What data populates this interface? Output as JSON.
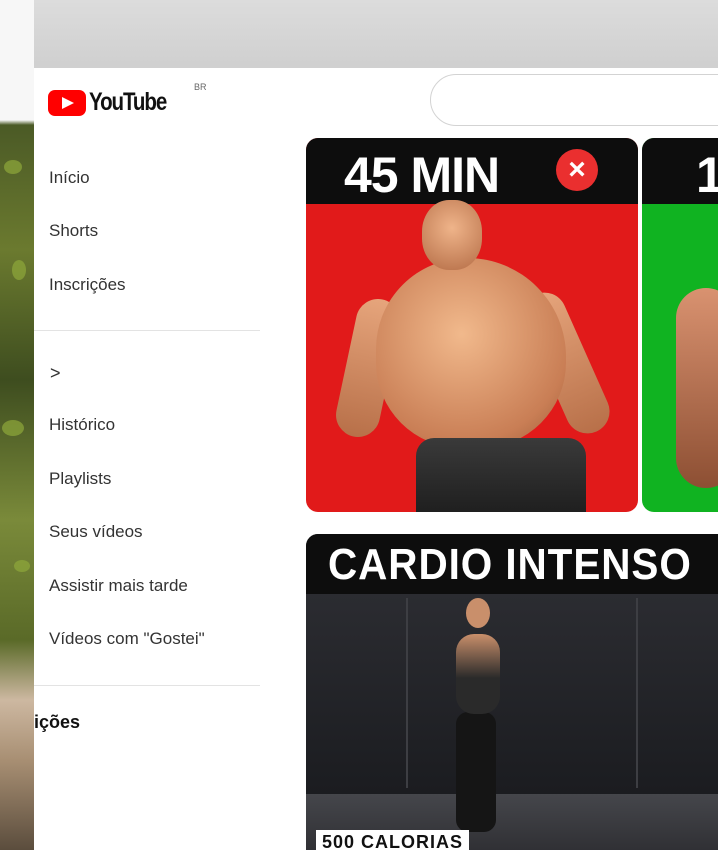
{
  "app": {
    "logo_text": "YouTube",
    "country_code": "BR"
  },
  "search": {
    "placeholder": ""
  },
  "sidebar": {
    "primary": [
      {
        "label": "Início"
      },
      {
        "label": "Shorts"
      },
      {
        "label": "Inscrições"
      }
    ],
    "you_chevron": ">",
    "library": [
      {
        "label": "Histórico"
      },
      {
        "label": "Playlists"
      },
      {
        "label": "Seus vídeos"
      },
      {
        "label": "Assistir mais tarde"
      },
      {
        "label": "Vídeos com \"Gostei\""
      }
    ],
    "subscriptions_partial": "ições"
  },
  "videos": [
    {
      "thumb_title": "45 MIN",
      "badge": "×",
      "color": "#e11a1a"
    },
    {
      "thumb_title": "1",
      "color": "#10b321"
    },
    {
      "thumb_title": "CARDIO INTENSO",
      "overlay": "500 CALORIAS"
    }
  ],
  "colors": {
    "brand": "#ff0000",
    "text": "#333333",
    "divider": "#e3e3e3"
  }
}
